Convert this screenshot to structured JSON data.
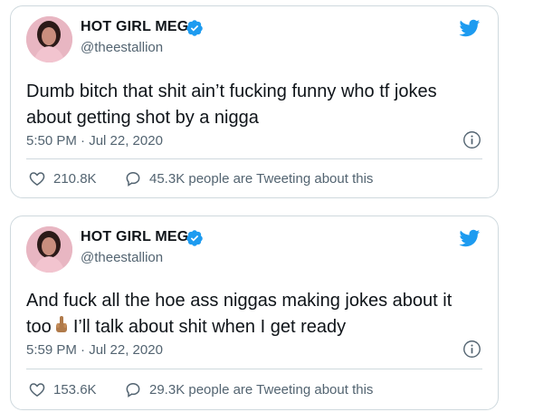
{
  "tweets": [
    {
      "display_name": "HOT GIRL MEG",
      "handle": "@theestallion",
      "text_line1": "Dumb bitch that shit ain’t fucking funny who tf jokes",
      "text_line2": "about getting shot by a nigga",
      "timestamp": "5:50 PM · Jul 22, 2020",
      "likes": "210.8K",
      "tweeting": "45.3K people are Tweeting about this"
    },
    {
      "display_name": "HOT GIRL MEG",
      "handle": "@theestallion",
      "text_line1": "And fuck all the hoe ass niggas making jokes about it",
      "text_line2_pre": "too",
      "text_line2_post": "I’ll talk about shit when I get ready",
      "timestamp": "5:59 PM · Jul 22, 2020",
      "likes": "153.6K",
      "tweeting": "29.3K people are Tweeting about this"
    }
  ],
  "icons": {
    "brand": "twitter-bird-icon",
    "verified": "verified-badge-icon",
    "info": "info-icon",
    "like": "heart-icon",
    "reply": "speech-bubble-icon",
    "emoji": "middle-finger-emoji"
  },
  "colors": {
    "twitter_blue": "#1d9bf0",
    "text_primary": "#0f1419",
    "text_secondary": "#536471",
    "border": "#cfd9de"
  }
}
